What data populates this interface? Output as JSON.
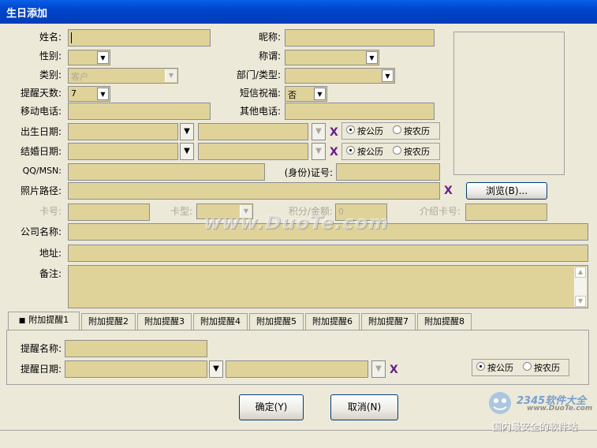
{
  "window": {
    "title": "生日添加"
  },
  "labels": {
    "name": "姓名:",
    "nickname": "昵称:",
    "gender": "性别:",
    "title": "称谓:",
    "category": "类别:",
    "dept": "部门/类型:",
    "remind_days": "提醒天数:",
    "sms": "短信祝福:",
    "mobile": "移动电话:",
    "other_phone": "其他电话:",
    "birth_date": "出生日期:",
    "wedding_date": "结婚日期:",
    "qq": "QQ/MSN:",
    "id_card": "(身份)证号:",
    "photo_path": "照片路径:",
    "card_no": "卡号:",
    "card_type": "卡型:",
    "points": "积分/金额:",
    "referrer_card": "介绍卡号:",
    "company": "公司名称:",
    "address": "地址:",
    "notes": "备注:"
  },
  "values": {
    "category": "客户",
    "remind_days": "7",
    "sms": "否",
    "points": "0"
  },
  "calendar": {
    "solar": "按公历",
    "lunar": "按农历"
  },
  "clear_mark": "X",
  "browse_button": "浏览(B)...",
  "tabs": [
    "附加提醒1",
    "附加提醒2",
    "附加提醒3",
    "附加提醒4",
    "附加提醒5",
    "附加提醒6",
    "附加提醒7",
    "附加提醒8"
  ],
  "active_tab_marker": "■",
  "extra": {
    "remind_name": "提醒名称:",
    "remind_date": "提醒日期:"
  },
  "buttons": {
    "ok": "确定(Y)",
    "cancel": "取消(N)"
  },
  "watermark": {
    "center": "www.DuoTe.com",
    "brand": "2345软件大全",
    "brand_url": "www.DuoTe.com",
    "slogan": "国内最安全的软件站"
  }
}
